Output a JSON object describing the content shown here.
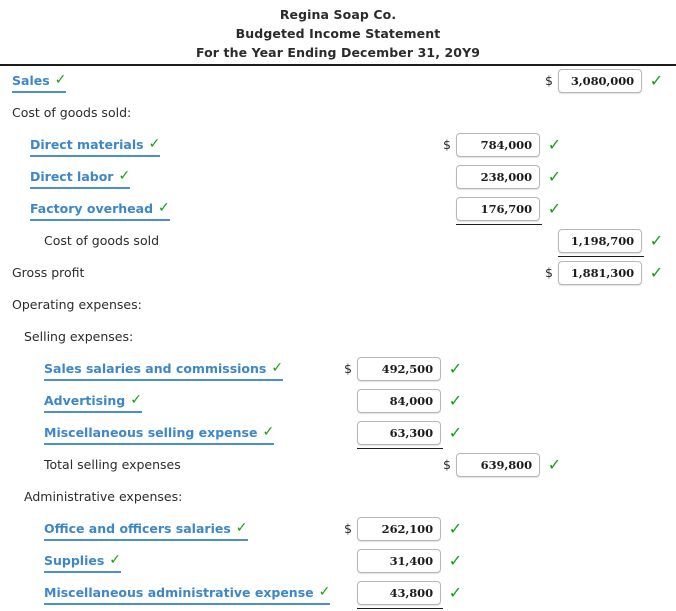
{
  "document": {
    "company": "Regina Soap Co.",
    "statement": "Budgeted Income Statement",
    "period": "For the Year Ending December 31, 20Y9"
  },
  "icons": {
    "check": "✓",
    "dollar": "$"
  },
  "colors": {
    "field_blue": "#3d87c9",
    "check_green": "#11a011",
    "rule_black": "#1d1d1d",
    "box_border": "#b7b7b7"
  },
  "rows": [
    {
      "label": "Sales",
      "kind": "field",
      "indent": 0,
      "label_check": "✓",
      "amount": "3,080,000",
      "column": "c3",
      "dollar": "$",
      "row_check": "✓",
      "rule_after": null
    },
    {
      "label": "Cost of goods sold:",
      "kind": "plain",
      "indent": 0,
      "label_check": "",
      "amount": "",
      "column": "",
      "dollar": "",
      "row_check": "",
      "rule_after": null
    },
    {
      "label": "Direct materials",
      "kind": "field",
      "indent": 2,
      "label_check": "✓",
      "amount": "784,000",
      "column": "c2",
      "dollar": "$",
      "row_check": "✓",
      "rule_after": null
    },
    {
      "label": "Direct labor",
      "kind": "field",
      "indent": 2,
      "label_check": "✓",
      "amount": "238,000",
      "column": "c2",
      "dollar": "",
      "row_check": "✓",
      "rule_after": null
    },
    {
      "label": "Factory overhead",
      "kind": "field",
      "indent": 2,
      "label_check": "✓",
      "amount": "176,700",
      "column": "c2",
      "dollar": "",
      "row_check": "✓",
      "rule_after": "c2"
    },
    {
      "label": "Cost of goods sold",
      "kind": "plain",
      "indent": 3,
      "label_check": "",
      "amount": "1,198,700",
      "column": "c3",
      "dollar": "",
      "row_check": "✓",
      "rule_after": "c3"
    },
    {
      "label": "Gross profit",
      "kind": "plain",
      "indent": 0,
      "label_check": "",
      "amount": "1,881,300",
      "column": "c3",
      "dollar": "$",
      "row_check": "✓",
      "rule_after": null
    },
    {
      "label": "Operating expenses:",
      "kind": "plain",
      "indent": 0,
      "label_check": "",
      "amount": "",
      "column": "",
      "dollar": "",
      "row_check": "",
      "rule_after": null
    },
    {
      "label": "Selling expenses:",
      "kind": "plain",
      "indent": 1,
      "label_check": "",
      "amount": "",
      "column": "",
      "dollar": "",
      "row_check": "",
      "rule_after": null
    },
    {
      "label": "Sales salaries and commissions",
      "kind": "field",
      "indent": 3,
      "label_check": "✓",
      "amount": "492,500",
      "column": "c1",
      "dollar": "$",
      "row_check": "✓",
      "rule_after": null
    },
    {
      "label": "Advertising",
      "kind": "field",
      "indent": 3,
      "label_check": "✓",
      "amount": "84,000",
      "column": "c1",
      "dollar": "",
      "row_check": "✓",
      "rule_after": null
    },
    {
      "label": "Miscellaneous selling expense",
      "kind": "field",
      "indent": 3,
      "label_check": "✓",
      "amount": "63,300",
      "column": "c1",
      "dollar": "",
      "row_check": "✓",
      "rule_after": "c1"
    },
    {
      "label": "Total selling expenses",
      "kind": "plain",
      "indent": 3,
      "label_check": "",
      "amount": "639,800",
      "column": "c2",
      "dollar": "$",
      "row_check": "✓",
      "rule_after": null
    },
    {
      "label": "Administrative expenses:",
      "kind": "plain",
      "indent": 1,
      "label_check": "",
      "amount": "",
      "column": "",
      "dollar": "",
      "row_check": "",
      "rule_after": null
    },
    {
      "label": "Office and officers salaries",
      "kind": "field",
      "indent": 3,
      "label_check": "✓",
      "amount": "262,100",
      "column": "c1",
      "dollar": "$",
      "row_check": "✓",
      "rule_after": null
    },
    {
      "label": "Supplies",
      "kind": "field",
      "indent": 3,
      "label_check": "✓",
      "amount": "31,400",
      "column": "c1",
      "dollar": "",
      "row_check": "✓",
      "rule_after": null
    },
    {
      "label": "Miscellaneous administrative expense",
      "kind": "field",
      "indent": 3,
      "label_check": "✓",
      "amount": "43,800",
      "column": "c1",
      "dollar": "",
      "row_check": "✓",
      "rule_after": "c1"
    }
  ]
}
